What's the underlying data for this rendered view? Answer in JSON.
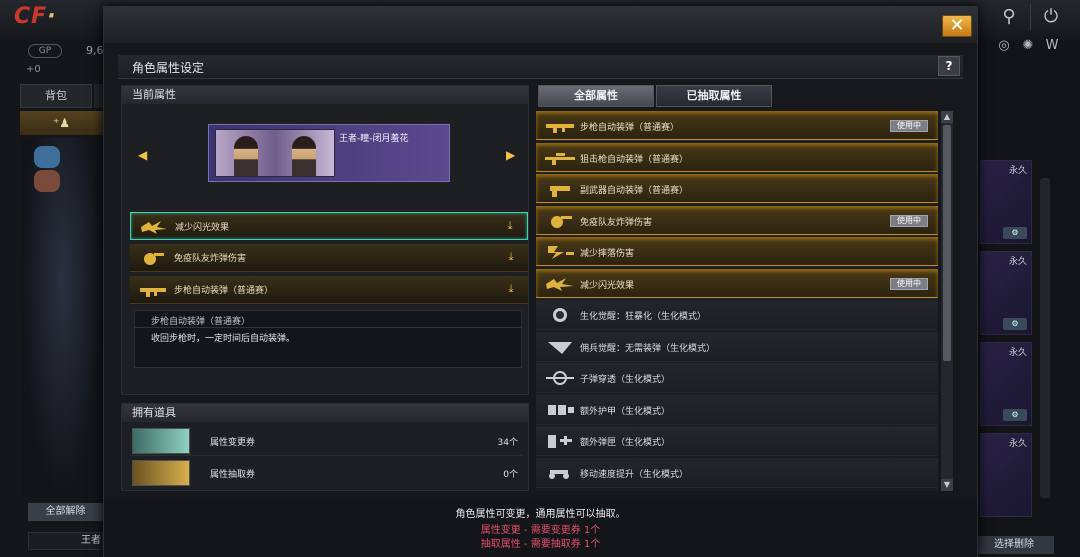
{
  "background": {
    "gp_label": "GP",
    "gp_value": "9,6",
    "small_label": "+0",
    "tab_backpack": "背包",
    "left_unequip_all": "全部解除",
    "left_name": "王者",
    "slot_tag": "永久",
    "select_delete": "选择删除"
  },
  "dialog": {
    "title": "角色属性设定",
    "help": "?",
    "close": "✕"
  },
  "current_attrs": {
    "heading": "当前属性",
    "character_name": "王者-瞳-闭月羞花",
    "attrs": [
      {
        "label": "减少闪光效果",
        "icon": "flash-icon"
      },
      {
        "label": "免疫队友炸弹伤害",
        "icon": "grenade-icon"
      },
      {
        "label": "步枪自动装弹（普通赛）",
        "icon": "rifle-icon"
      }
    ],
    "desc_title": "步枪自动装弹（普通赛）",
    "desc_text": "收回步枪时，一定时间后自动装弹。"
  },
  "items": {
    "heading": "拥有道具",
    "list": [
      {
        "name": "属性变更券",
        "count": "34个"
      },
      {
        "name": "属性抽取券",
        "count": "0个"
      }
    ]
  },
  "tabs": {
    "all": "全部属性",
    "extracted": "已抽取属性"
  },
  "attr_list": [
    {
      "label": "步枪自动装弹（普通赛）",
      "style": "gold",
      "use": "使用中",
      "icon": "rifle-icon"
    },
    {
      "label": "狙击枪自动装弹（普通赛）",
      "style": "gold",
      "use": "",
      "icon": "sniper-icon"
    },
    {
      "label": "副武器自动装弹（普通赛）",
      "style": "gold",
      "use": "",
      "icon": "pistol-icon"
    },
    {
      "label": "免疫队友炸弹伤害",
      "style": "gold",
      "use": "使用中",
      "icon": "grenade-icon"
    },
    {
      "label": "减少摔落伤害",
      "style": "gold",
      "use": "",
      "icon": "fall-icon"
    },
    {
      "label": "减少闪光效果",
      "style": "gold",
      "use": "使用中",
      "icon": "flash-icon"
    },
    {
      "label": "生化觉醒：狂暴化（生化模式）",
      "style": "dark",
      "use": "",
      "icon": "rage-icon"
    },
    {
      "label": "佣兵觉醒：无需装弹（生化模式）",
      "style": "dark",
      "use": "",
      "icon": "ammo-icon"
    },
    {
      "label": "子弹穿透（生化模式）",
      "style": "dark",
      "use": "",
      "icon": "penetration-icon"
    },
    {
      "label": "额外护甲（生化模式）",
      "style": "dark",
      "use": "",
      "icon": "armor-icon"
    },
    {
      "label": "额外弹匣（生化模式）",
      "style": "dark",
      "use": "",
      "icon": "magazine-icon"
    },
    {
      "label": "移动速度提升（生化模式）",
      "style": "dark",
      "use": "",
      "icon": "speed-icon"
    }
  ],
  "footer": {
    "line1": "角色属性可变更，通用属性可以抽取。",
    "line2": "属性变更 - 需要变更券 1个",
    "line3": "抽取属性 - 需要抽取券 1个",
    "line1_color": "#e8eaee",
    "line2_color": "#e0506a",
    "line3_color": "#e0506a"
  },
  "colors": {
    "accent_gold": "#e0b43c",
    "selected_border": "#3fd1b0"
  }
}
